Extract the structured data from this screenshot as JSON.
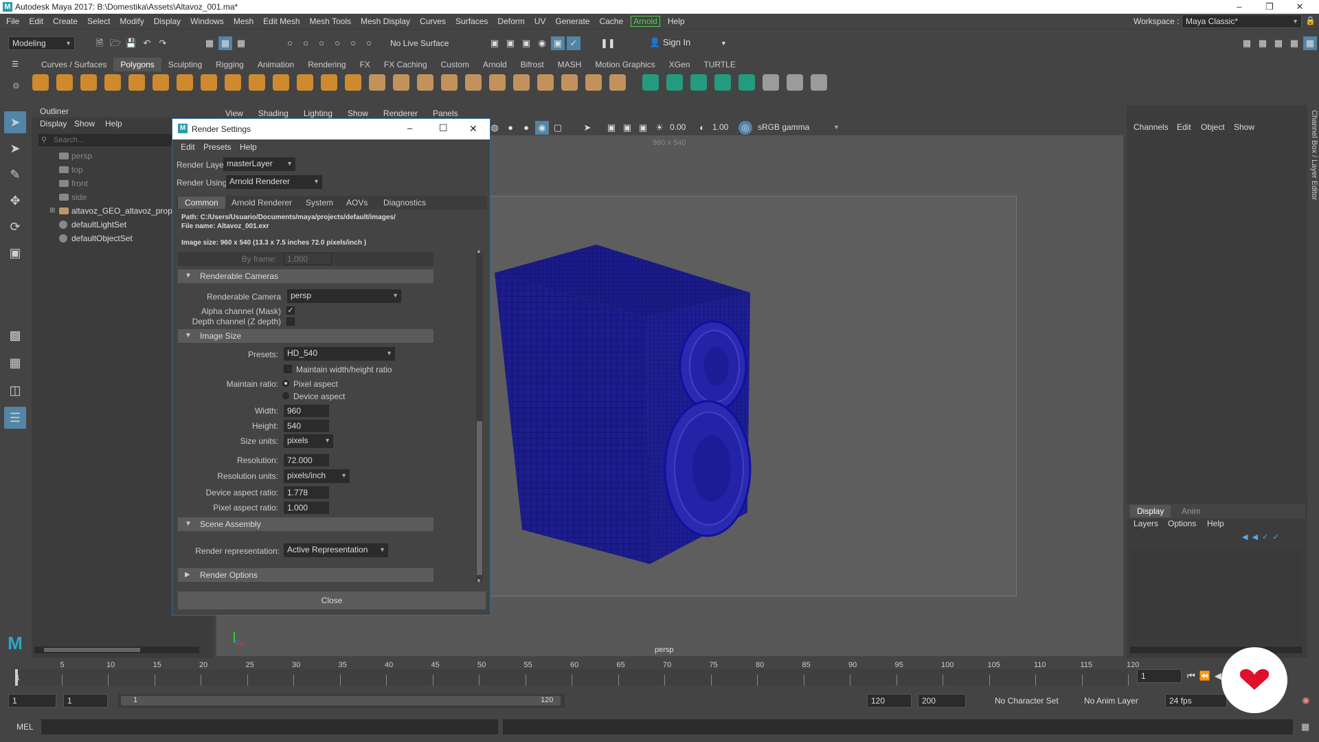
{
  "window": {
    "title": "Autodesk Maya 2017: B:\\Domestika\\Assets\\Altavoz_001.ma*"
  },
  "menubar": {
    "items": [
      "File",
      "Edit",
      "Create",
      "Select",
      "Modify",
      "Display",
      "Windows",
      "Mesh",
      "Edit Mesh",
      "Mesh Tools",
      "Mesh Display",
      "Curves",
      "Surfaces",
      "Deform",
      "UV",
      "Generate",
      "Cache"
    ],
    "arnold": "Arnold",
    "help": "Help",
    "workspace_label": "Workspace :",
    "workspace_value": "Maya Classic*"
  },
  "statusline": {
    "mode": "Modeling",
    "live_surface": "No Live Surface",
    "sign_in": "Sign In"
  },
  "shelf": {
    "tabs": [
      "Curves / Surfaces",
      "Polygons",
      "Sculpting",
      "Rigging",
      "Animation",
      "Rendering",
      "FX",
      "FX Caching",
      "Custom",
      "Arnold",
      "Bifrost",
      "MASH",
      "Motion Graphics",
      "XGen",
      "TURTLE"
    ],
    "active_tab": "Polygons"
  },
  "outliner": {
    "title": "Outliner",
    "menu": [
      "Display",
      "Show",
      "Help"
    ],
    "search_placeholder": "Search...",
    "items": [
      "persp",
      "top",
      "front",
      "side",
      "altavoz_GEO_altavoz_prop_N",
      "defaultLightSet",
      "defaultObjectSet"
    ]
  },
  "viewport": {
    "menu": [
      "View",
      "Shading",
      "Lighting",
      "Show",
      "Renderer",
      "Panels"
    ],
    "exposure": "0.00",
    "gamma": "1.00",
    "color_space": "sRGB gamma",
    "resolution_label": "960 x 540",
    "camera_label": "persp"
  },
  "channelbox": {
    "menu": [
      "Channels",
      "Edit",
      "Object",
      "Show"
    ],
    "side_label": "Channel Box / Layer Editor",
    "layer_tabs": [
      "Display",
      "Anim"
    ],
    "layer_menu": [
      "Layers",
      "Options",
      "Help"
    ]
  },
  "timeline": {
    "ticks": [
      "5",
      "10",
      "15",
      "20",
      "25",
      "30",
      "35",
      "40",
      "45",
      "50",
      "55",
      "60",
      "65",
      "70",
      "75",
      "80",
      "85",
      "90",
      "95",
      "100",
      "105",
      "110",
      "115",
      "120"
    ],
    "start_tick": "1",
    "current_frame": "1",
    "range_start": "1",
    "range_start2": "1",
    "range_inner_start": "1",
    "range_inner_end": "120",
    "range_end": "120",
    "anim_end": "200",
    "character_set": "No Character Set",
    "anim_layer": "No Anim Layer",
    "fps": "24 fps"
  },
  "cmdline": {
    "label": "MEL"
  },
  "render_settings": {
    "title": "Render Settings",
    "menu": [
      "Edit",
      "Presets",
      "Help"
    ],
    "render_layer_label": "Render Layer",
    "render_layer": "masterLayer",
    "render_using_label": "Render Using",
    "render_using": "Arnold Renderer",
    "tabs": [
      "Common",
      "Arnold Renderer",
      "System",
      "AOVs",
      "Diagnostics"
    ],
    "active_tab": "Common",
    "path": "Path: C:/Users/Usuario/Documents/maya/projects/default/images/",
    "file_name": "File name:  Altavoz_001.exr",
    "image_size_info": "Image size: 960 x 540 (13.3 x 7.5 inches 72.0 pixels/inch )",
    "by_frame_label": "By frame:",
    "by_frame": "1.000",
    "sections": {
      "renderable_cameras": "Renderable Cameras",
      "image_size": "Image Size",
      "scene_assembly": "Scene Assembly",
      "render_options": "Render Options"
    },
    "renderable_camera_label": "Renderable Camera",
    "renderable_camera": "persp",
    "alpha_label": "Alpha channel (Mask)",
    "depth_label": "Depth channel (Z depth)",
    "presets_label": "Presets:",
    "presets": "HD_540",
    "maintain_wh_label": "Maintain width/height ratio",
    "maintain_ratio_label": "Maintain ratio:",
    "pixel_aspect": "Pixel aspect",
    "device_aspect": "Device aspect",
    "width_label": "Width:",
    "width": "960",
    "height_label": "Height:",
    "height": "540",
    "size_units_label": "Size units:",
    "size_units": "pixels",
    "resolution_label": "Resolution:",
    "resolution": "72.000",
    "resolution_units_label": "Resolution units:",
    "resolution_units": "pixels/inch",
    "device_aspect_label": "Device aspect ratio:",
    "device_aspect_ratio": "1.778",
    "pixel_aspect_label": "Pixel aspect ratio:",
    "pixel_aspect_ratio": "1.000",
    "render_rep_label": "Render representation:",
    "render_rep": "Active Representation",
    "close": "Close"
  }
}
